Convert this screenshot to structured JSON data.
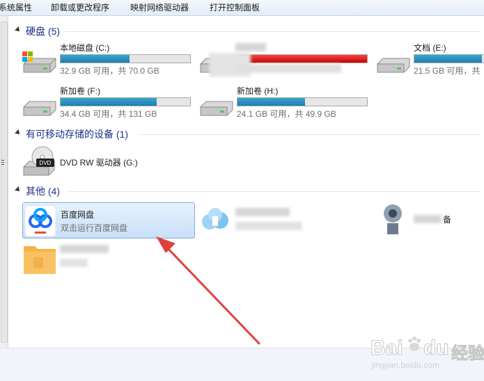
{
  "toolbar": {
    "system_properties": "系统属性",
    "uninstall": "卸载或更改程序",
    "map_drive": "映射网络驱动器",
    "control_panel": "打开控制面板"
  },
  "sections": {
    "hdd": "硬盘 (5)",
    "removable": "有可移动存储的设备 (1)",
    "other": "其他 (4)"
  },
  "drives": [
    {
      "name": "本地磁盘 (C:)",
      "free": "32.9 GB 可用，共 70.0 GB",
      "used_fraction": 0.53
    },
    {
      "name": "",
      "free": "",
      "used_fraction": 1.0
    },
    {
      "name": "文档 (E:)",
      "free": "21.5 GB 可用，共",
      "used_fraction": 0.88
    },
    {
      "name": "新加卷 (F:)",
      "free": "34.4 GB 可用，共 131 GB",
      "used_fraction": 0.74
    },
    {
      "name": "新加卷 (H:)",
      "free": "24.1 GB 可用，共 49.9 GB",
      "used_fraction": 0.52
    }
  ],
  "dvd": {
    "name": "DVD RW 驱动器 (G:)",
    "icon_label": "DVD"
  },
  "other": {
    "baidu": {
      "name": "百度网盘",
      "sub": "双击运行百度网盘"
    },
    "item3_tail": "备"
  },
  "watermark": {
    "brand": "Bai",
    "paw": "du",
    "cn": "经验",
    "url": "jingyan.baidu.com"
  },
  "colors": {
    "bar_fill": "#1c7fae",
    "bar_red": "#cc0000",
    "arrow": "#e0403c",
    "section_text": "#1e3287"
  }
}
